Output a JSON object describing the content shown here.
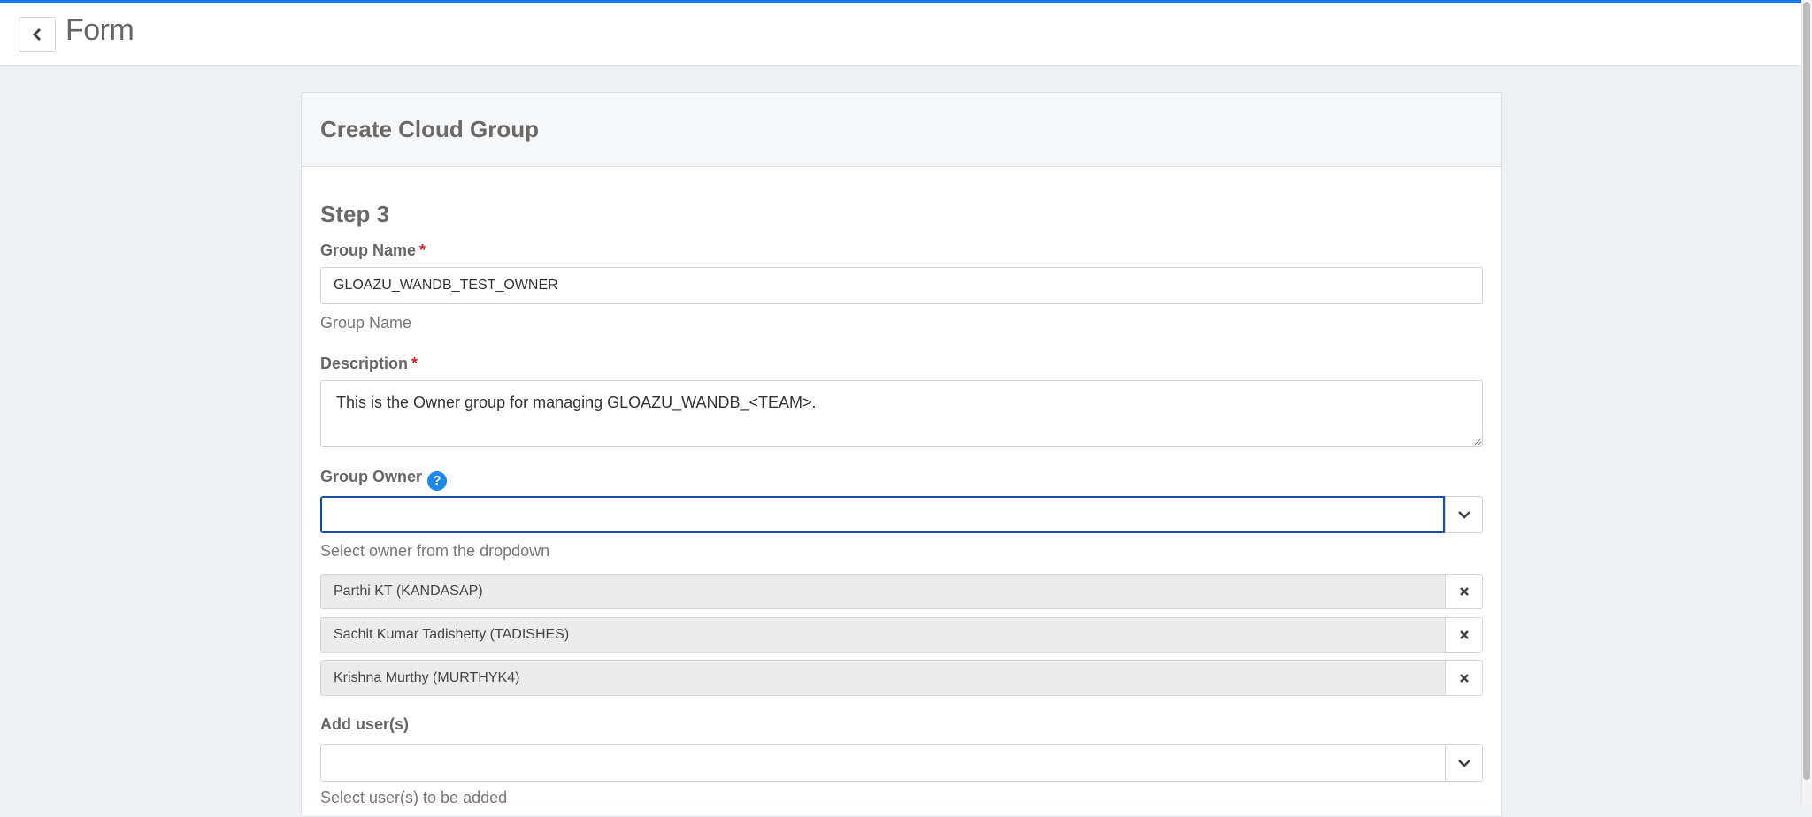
{
  "header": {
    "title": "Form"
  },
  "card": {
    "title": "Create Cloud Group",
    "step_title": "Step 3"
  },
  "group_name": {
    "label": "Group Name",
    "required_mark": "*",
    "value": "GLOAZU_WANDB_TEST_OWNER",
    "help": "Group Name"
  },
  "description": {
    "label": "Description",
    "required_mark": "*",
    "value": "This is the Owner group for managing GLOAZU_WANDB_<TEAM>."
  },
  "group_owner": {
    "label": "Group Owner",
    "help_icon": "?",
    "value": "",
    "help": "Select owner from the dropdown",
    "selected": [
      {
        "label": "Parthi KT (KANDASAP)"
      },
      {
        "label": "Sachit Kumar Tadishetty (TADISHES)"
      },
      {
        "label": "Krishna Murthy (MURTHYK4)"
      }
    ]
  },
  "add_users": {
    "label": "Add user(s)",
    "value": "",
    "help": "Select user(s) to be added"
  },
  "colors": {
    "accent": "#1a73e8",
    "help_icon": "#1e88e5",
    "required": "#c62828",
    "focus_border": "#1a4f99"
  }
}
